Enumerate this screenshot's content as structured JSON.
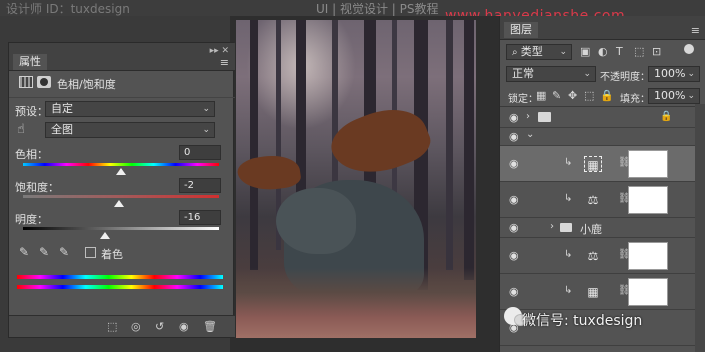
{
  "watermarks": {
    "top_left": "设计师 ID：tuxdesign",
    "top_center": "UI | 视觉设计 | PS教程",
    "top_right": "www.hanyedianshe.com",
    "wechat": "微信号: tuxdesign"
  },
  "properties_panel": {
    "tab": "属性",
    "adjustment_title": "色相/饱和度",
    "preset_label": "预设：",
    "preset_value": "自定",
    "channel_value": "全图",
    "hue": {
      "label": "色相：",
      "value": "0",
      "level": 0.5
    },
    "saturation": {
      "label": "饱和度：",
      "value": "-2",
      "level": 0.49
    },
    "lightness": {
      "label": "明度：",
      "value": "-16",
      "level": 0.42
    },
    "colorize_label": "着色"
  },
  "layers_panel": {
    "tab": "图层",
    "filter_value": "类型",
    "blend_mode": "正常",
    "opacity_label": "不透明度：",
    "opacity_value": "100%",
    "lock_label": "锁定：",
    "fill_label": "填充：",
    "fill_value": "100%",
    "group_name": "小鹿"
  },
  "colors": {
    "panel_bg": "#535353",
    "panel_header": "#424242",
    "accent_watermark": "#d93a4a"
  }
}
